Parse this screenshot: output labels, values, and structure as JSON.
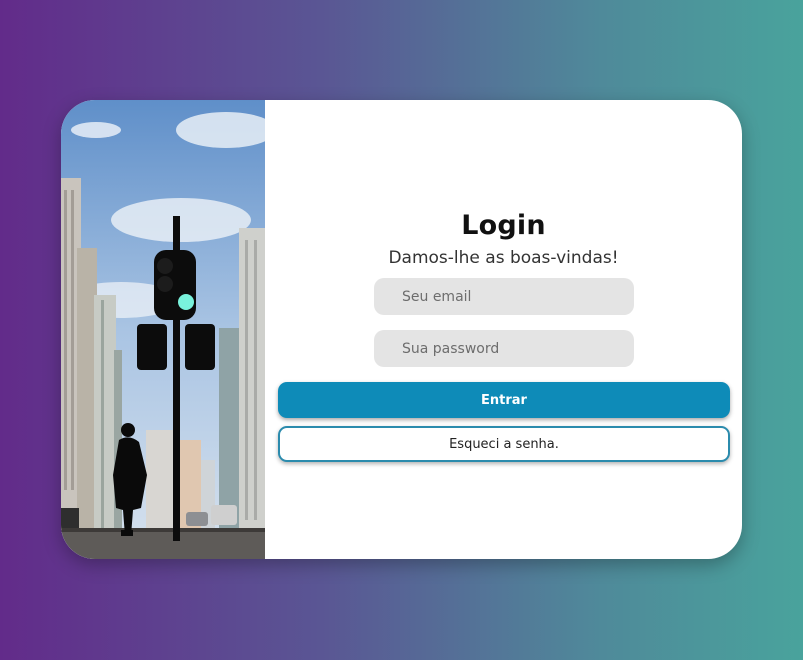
{
  "login": {
    "title": "Login",
    "subtitle": "Damos-lhe as boas-vindas!",
    "email_placeholder": "Seu email",
    "password_placeholder": "Sua password",
    "submit_label": "Entrar",
    "forgot_label": "Esqueci a senha."
  },
  "colors": {
    "background_left": "#622b8a",
    "background_right": "#49a39c",
    "primary_button": "#0e8bb8",
    "input_background": "#e4e4e4"
  }
}
